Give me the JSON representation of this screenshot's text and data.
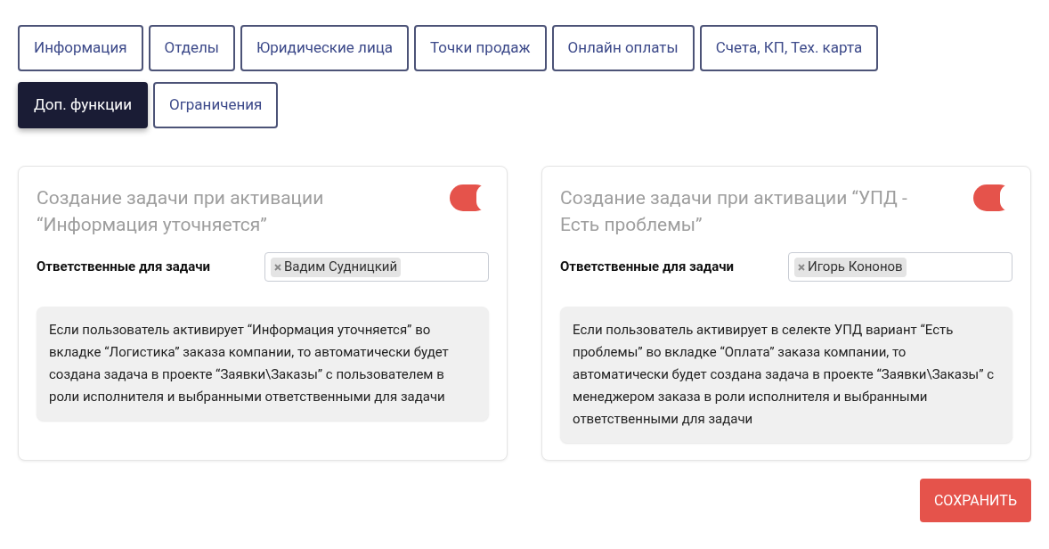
{
  "tabs": [
    {
      "label": "Информация",
      "selected": false
    },
    {
      "label": "Отделы",
      "selected": false
    },
    {
      "label": "Юридические лица",
      "selected": false
    },
    {
      "label": "Точки продаж",
      "selected": false
    },
    {
      "label": "Онлайн оплаты",
      "selected": false
    },
    {
      "label": "Счета, КП, Тех. карта",
      "selected": false
    },
    {
      "label": "Доп. функции",
      "selected": true
    },
    {
      "label": "Ограничения",
      "selected": false
    }
  ],
  "cards": [
    {
      "title": "Создание задачи при активации “Информация уточняется”",
      "on": true,
      "field_label": "Ответственные для задачи",
      "tags": [
        "Вадим Судницкий"
      ],
      "description": "Если пользователь активирует “Информация уточняется” во вкладке “Логистика” заказа компании, то автоматически будет создана задача в проекте “Заявки\\Заказы” с пользователем в роли исполнителя и выбранными ответственными для задачи"
    },
    {
      "title": "Создание задачи при активации “УПД - Есть проблемы”",
      "on": true,
      "field_label": "Ответственные для задачи",
      "tags": [
        "Игорь Кононов"
      ],
      "description": "Если пользователь активирует в селекте УПД вариант “Есть проблемы” во вкладке “Оплата” заказа компании, то автоматически будет создана задача в проекте “Заявки\\Заказы” с менеджером заказа в роли исполнителя и выбранными ответственными для задачи"
    }
  ],
  "save_button": "СОХРАНИТЬ"
}
